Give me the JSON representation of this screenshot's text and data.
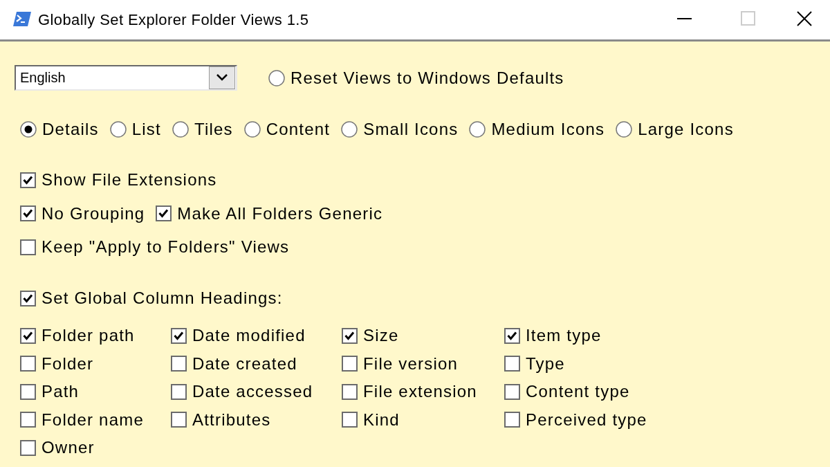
{
  "window": {
    "title": "Globally Set Explorer Folder Views 1.5",
    "controls": [
      {
        "kind": "minimize",
        "disabled": false
      },
      {
        "kind": "maximize",
        "disabled": true
      },
      {
        "kind": "close",
        "disabled": false
      }
    ]
  },
  "language_select": {
    "value": "English"
  },
  "reset_option": {
    "label": "Reset Views to Windows Defaults",
    "selected": false
  },
  "view_modes": [
    {
      "label": "Details",
      "selected": true
    },
    {
      "label": "List",
      "selected": false
    },
    {
      "label": "Tiles",
      "selected": false
    },
    {
      "label": "Content",
      "selected": false
    },
    {
      "label": "Small Icons",
      "selected": false
    },
    {
      "label": "Medium Icons",
      "selected": false
    },
    {
      "label": "Large Icons",
      "selected": false
    }
  ],
  "option_rows": [
    {
      "items": [
        {
          "label": "Show File Extensions",
          "checked": true
        }
      ]
    },
    {
      "items": [
        {
          "label": "No Grouping",
          "checked": true
        },
        {
          "label": "Make All Folders Generic",
          "checked": true
        }
      ]
    },
    {
      "items": [
        {
          "label": "Keep \"Apply to Folders\" Views",
          "checked": false
        }
      ]
    }
  ],
  "column_headings": {
    "label": "Set Global Column Headings:",
    "checked": true,
    "columns": [
      {
        "items": [
          {
            "label": "Folder path",
            "checked": true
          },
          {
            "label": "Folder",
            "checked": false
          },
          {
            "label": "Path",
            "checked": false
          },
          {
            "label": "Folder name",
            "checked": false
          },
          {
            "label": "Owner",
            "checked": false
          }
        ]
      },
      {
        "items": [
          {
            "label": "Date modified",
            "checked": true
          },
          {
            "label": "Date created",
            "checked": false
          },
          {
            "label": "Date accessed",
            "checked": false
          },
          {
            "label": "Attributes",
            "checked": false
          }
        ]
      },
      {
        "items": [
          {
            "label": "Size",
            "checked": true
          },
          {
            "label": "File version",
            "checked": false
          },
          {
            "label": "File extension",
            "checked": false
          },
          {
            "label": "Kind",
            "checked": false
          }
        ]
      },
      {
        "items": [
          {
            "label": "Item type",
            "checked": true
          },
          {
            "label": "Type",
            "checked": false
          },
          {
            "label": "Content type",
            "checked": false
          },
          {
            "label": "Perceived type",
            "checked": false
          }
        ]
      }
    ]
  }
}
